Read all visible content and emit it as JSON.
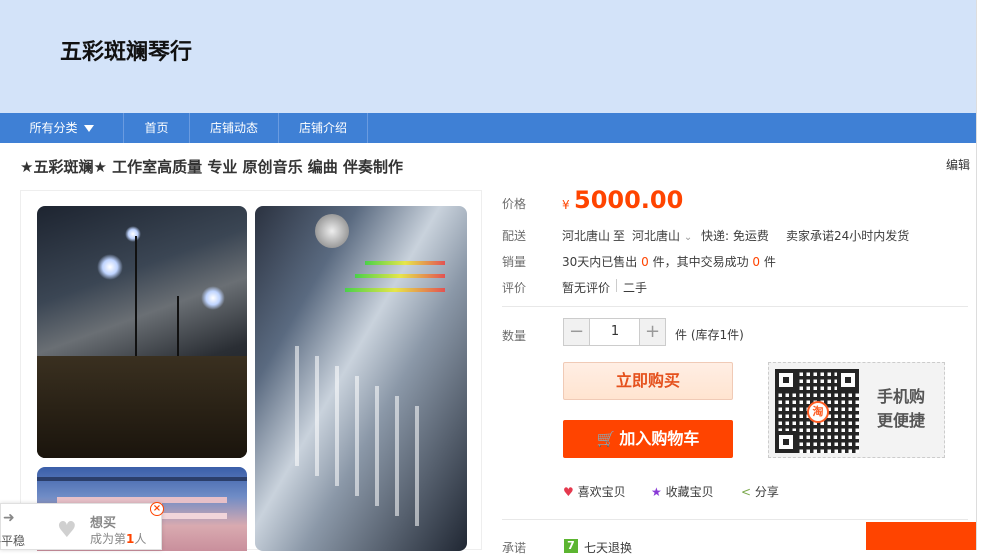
{
  "shop": {
    "name": "五彩斑斓琴行"
  },
  "nav": {
    "items": [
      "所有分类",
      "首页",
      "店铺动态",
      "店铺介绍"
    ]
  },
  "item": {
    "title": "★五彩斑斓★ 工作室高质量 专业 原创音乐 编曲 伴奏制作",
    "edit": "编辑"
  },
  "price": {
    "label": "价格",
    "currency": "¥",
    "value": "5000.00"
  },
  "shipping": {
    "label": "配送",
    "from": "河北唐山",
    "to_word": "至",
    "to": "河北唐山",
    "express": "快递: 免运费",
    "promise": "卖家承诺24小时内发货"
  },
  "sales": {
    "label": "销量",
    "text1": "30天内已售出",
    "sold": "0",
    "text2": "件，其中交易成功",
    "success": "0",
    "text3": "件"
  },
  "review": {
    "label": "评价",
    "value": "暂无评价",
    "condition": "二手"
  },
  "quantity": {
    "label": "数量",
    "minus": "−",
    "value": "1",
    "plus": "+",
    "stock": "件 (库存1件)"
  },
  "buttons": {
    "buy_now": "立即购买",
    "add_cart": "加入购物车"
  },
  "mobile": {
    "line1": "手机购",
    "line2": "更便捷",
    "qr_logo": "淘"
  },
  "actions": {
    "like": "喜欢宝贝",
    "favorite": "收藏宝贝",
    "share": "分享"
  },
  "promise": {
    "label": "承诺",
    "badge": "7",
    "text": "七天退换"
  },
  "floating": {
    "left_text": "格平稳",
    "wish_title": "想买",
    "wish_sub_prefix": "成为第",
    "wish_rank": "1",
    "wish_sub_suffix": "人",
    "close": "×"
  },
  "colors": {
    "accent": "#ff4400",
    "nav": "#3f80d5",
    "banner": "#d3e3f9"
  }
}
